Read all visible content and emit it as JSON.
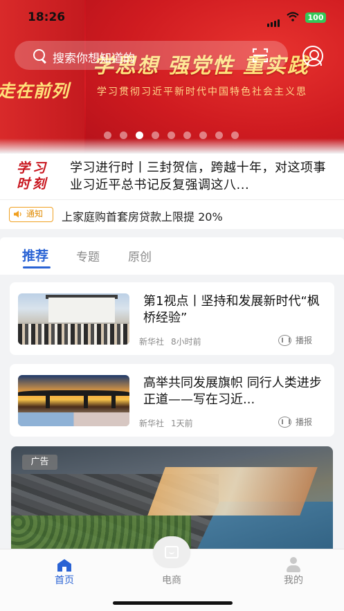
{
  "status_bar": {
    "time": "18:26",
    "battery": "100"
  },
  "banner": {
    "left_slogan": "走在前列",
    "slogan": "学思想 强党性 重实践",
    "subtitle": "学习贯彻习近平新时代中国特色社会主义思",
    "carousel_count": 9,
    "carousel_active_index": 2
  },
  "search": {
    "placeholder": "搜索你想知道的"
  },
  "headline": {
    "logo_line1": "学习",
    "logo_line2": "时刻",
    "text": "学习进行时丨三封贺信，跨越十年，对这项事业习近平总书记反复强调这八..."
  },
  "notice": {
    "tag": "通知",
    "message": "上家庭购首套房贷款上限提 20%"
  },
  "tabs": [
    {
      "label": "推荐",
      "active": true
    },
    {
      "label": "专题",
      "active": false
    },
    {
      "label": "原创",
      "active": false
    }
  ],
  "articles": [
    {
      "title": "第1视点丨坚持和发展新时代“枫桥经验”",
      "source": "新华社",
      "time": "8小时前",
      "action": "播报"
    },
    {
      "title": "高举共同发展旗帜 同行人类进步正道——写在习近...",
      "source": "新华社",
      "time": "1天前",
      "action": "播报"
    }
  ],
  "ad": {
    "badge": "广告"
  },
  "bottom_nav": [
    {
      "label": "首页",
      "icon": "home-icon",
      "active": true
    },
    {
      "label": "电商",
      "icon": "shopping-bag-icon",
      "active": false
    },
    {
      "label": "我的",
      "icon": "user-icon",
      "active": false
    }
  ],
  "colors": {
    "accent": "#2a63d4",
    "banner_red": "#d91c24",
    "notice": "#f0a020"
  }
}
